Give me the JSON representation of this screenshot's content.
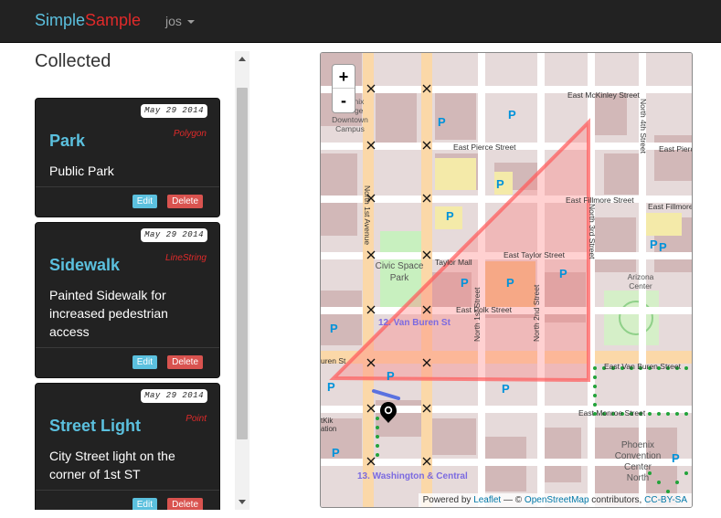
{
  "navbar": {
    "brand_part1": "Simple",
    "brand_part2": "Sample",
    "user": "jos"
  },
  "collected": {
    "title": "Collected",
    "items": [
      {
        "date": "May 29 2014",
        "type": "Polygon",
        "title": "Park",
        "description": "Public Park",
        "edit_label": "Edit",
        "delete_label": "Delete"
      },
      {
        "date": "May 29 2014",
        "type": "LineString",
        "title": "Sidewalk",
        "description": "Painted Sidewalk for increased pedestrian access",
        "edit_label": "Edit",
        "delete_label": "Delete"
      },
      {
        "date": "May 29 2014",
        "type": "Point",
        "title": "Street Light",
        "description": "City Street light on the corner of 1st ST",
        "edit_label": "Edit",
        "delete_label": "Delete"
      }
    ]
  },
  "map": {
    "zoom_in": "+",
    "zoom_out": "-",
    "labels": {
      "mckinley": "East McKinley Street",
      "pierce": "East Pierce Street",
      "pierce_right": "East Pierce",
      "fillmore": "East Fillmore Street",
      "fillmore_right": "East Fillmore",
      "taylor": "East Taylor Street",
      "taylor_short": "Taylor Mall",
      "polk": "East Polk Street",
      "van_buren": "East Van Buren Street",
      "van_buren_left": "uren St",
      "monroe": "East Monroe Street",
      "first_ave": "North 1st Avenue",
      "first_st": "North 1st Street",
      "second_st": "North 2nd Street",
      "third_st": "North 3rd Street",
      "fourth_st": "North 4th Street",
      "college_1": "Phoenix",
      "college_2": "College",
      "college_3": "Downtown",
      "college_4": "Campus",
      "civic_1": "Civic Space",
      "civic_2": "Park",
      "arizona_1": "Arizona",
      "arizona_2": "Center",
      "convention_1": "Phoenix",
      "convention_2": "Convention",
      "convention_3": "Center",
      "convention_4": "North",
      "station_van_buren": "12. Van Buren St",
      "station_washington": "13. Washington & Central",
      "kik_1": "tKik",
      "kik_2": "ation",
      "parking": "P"
    },
    "attribution": {
      "powered_by": "Powered by",
      "leaflet": "Leaflet",
      "separator": " — © ",
      "osm": "OpenStreetMap",
      "contributors": " contributors, ",
      "license": "CC-BY-SA"
    },
    "colors": {
      "polygon_fill": "#ff7a7a",
      "polygon_stroke": "#ff5a5a",
      "line": "#4a66e0",
      "marker": "#000000"
    }
  }
}
